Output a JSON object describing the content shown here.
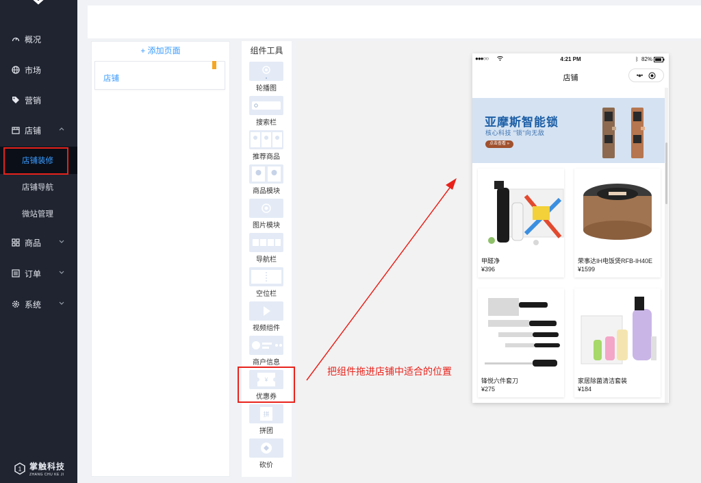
{
  "sidebar": {
    "items": [
      {
        "label": "概况",
        "icon": "dashboard-icon"
      },
      {
        "label": "市场",
        "icon": "globe-icon"
      },
      {
        "label": "营销",
        "icon": "tag-icon"
      },
      {
        "label": "店铺",
        "icon": "store-icon"
      }
    ],
    "store_sub": [
      "店铺装修",
      "店铺导航",
      "微站管理"
    ],
    "items2": [
      {
        "label": "商品",
        "icon": "grid-icon"
      },
      {
        "label": "订单",
        "icon": "list-icon"
      },
      {
        "label": "系统",
        "icon": "gear-icon"
      }
    ],
    "brand": {
      "name": "掌触科技",
      "sub": "ZHANG CHU KE JI"
    }
  },
  "pages": {
    "add_label": "+ 添加页面",
    "list": [
      "店铺"
    ]
  },
  "components": {
    "title": "组件工具",
    "items": [
      "轮播图",
      "搜索栏",
      "推荐商品",
      "商品模块",
      "图片模块",
      "导航栏",
      "空位栏",
      "视频组件",
      "商户信息",
      "优惠券",
      "拼团",
      "砍价"
    ]
  },
  "phone": {
    "signal": "●●●○○",
    "time": "4:21 PM",
    "battery": "82%",
    "title": "店铺",
    "banner": {
      "title": "亚摩斯智能锁",
      "subtitle": "核心科技 \"锁\"向无敌",
      "button": "点击查看 »"
    },
    "products": [
      {
        "name": "甲醛净",
        "price": "¥396"
      },
      {
        "name": "荣事达IH电饭煲RFB-IH40E",
        "price": "¥1599"
      },
      {
        "name": "锋悦六件套刀",
        "price": "¥275"
      },
      {
        "name": "家居除菌清洁套装",
        "price": "¥184"
      }
    ]
  },
  "annotation": "把组件拖进店铺中适合的位置",
  "colors": {
    "accent": "#3a9bff",
    "sidebar": "#1f2430",
    "highlight": "#e8221b"
  }
}
